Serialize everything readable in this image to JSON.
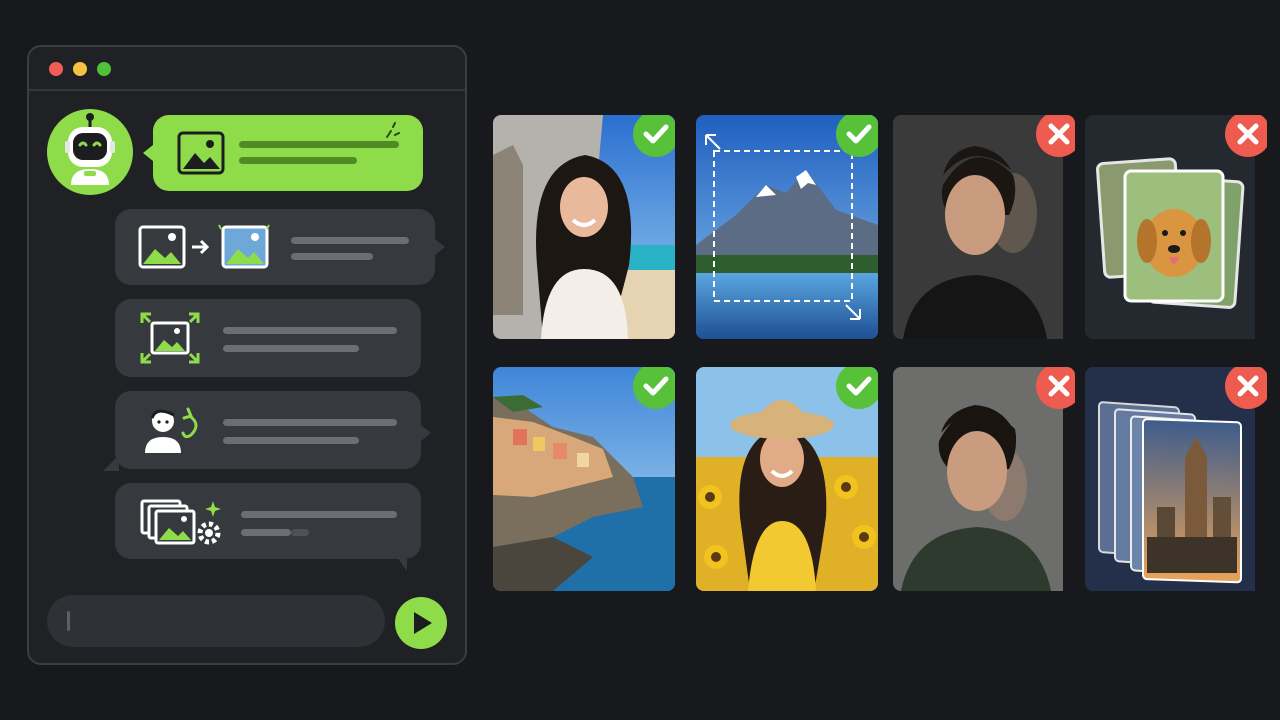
{
  "window": {
    "controls": [
      "close",
      "minimize",
      "maximize"
    ]
  },
  "assistant": {
    "avatar_icon": "robot-icon",
    "accent": "#8fdc4b"
  },
  "messages": [
    {
      "icon": "image-icon",
      "style": "assistant"
    },
    {
      "icon": "image-to-image-icon",
      "style": "user"
    },
    {
      "icon": "expand-image-icon",
      "style": "user"
    },
    {
      "icon": "face-swap-icon",
      "style": "user"
    },
    {
      "icon": "batch-settings-icon",
      "style": "user"
    }
  ],
  "composer": {
    "send_icon": "send-icon"
  },
  "results": [
    {
      "subject": "woman-beach-background-swap",
      "status": "ok"
    },
    {
      "subject": "mountain-lake-outpaint",
      "status": "ok"
    },
    {
      "subject": "man-portrait-ghosting",
      "status": "no"
    },
    {
      "subject": "dog-image-stack",
      "status": "no"
    },
    {
      "subject": "coastal-village",
      "status": "ok"
    },
    {
      "subject": "woman-sunflower-field",
      "status": "ok"
    },
    {
      "subject": "man-portrait-duplicate",
      "status": "no"
    },
    {
      "subject": "city-image-stack",
      "status": "no"
    }
  ],
  "colors": {
    "ok": "#57c13a",
    "no": "#ee5b4f",
    "background": "#17191c"
  }
}
